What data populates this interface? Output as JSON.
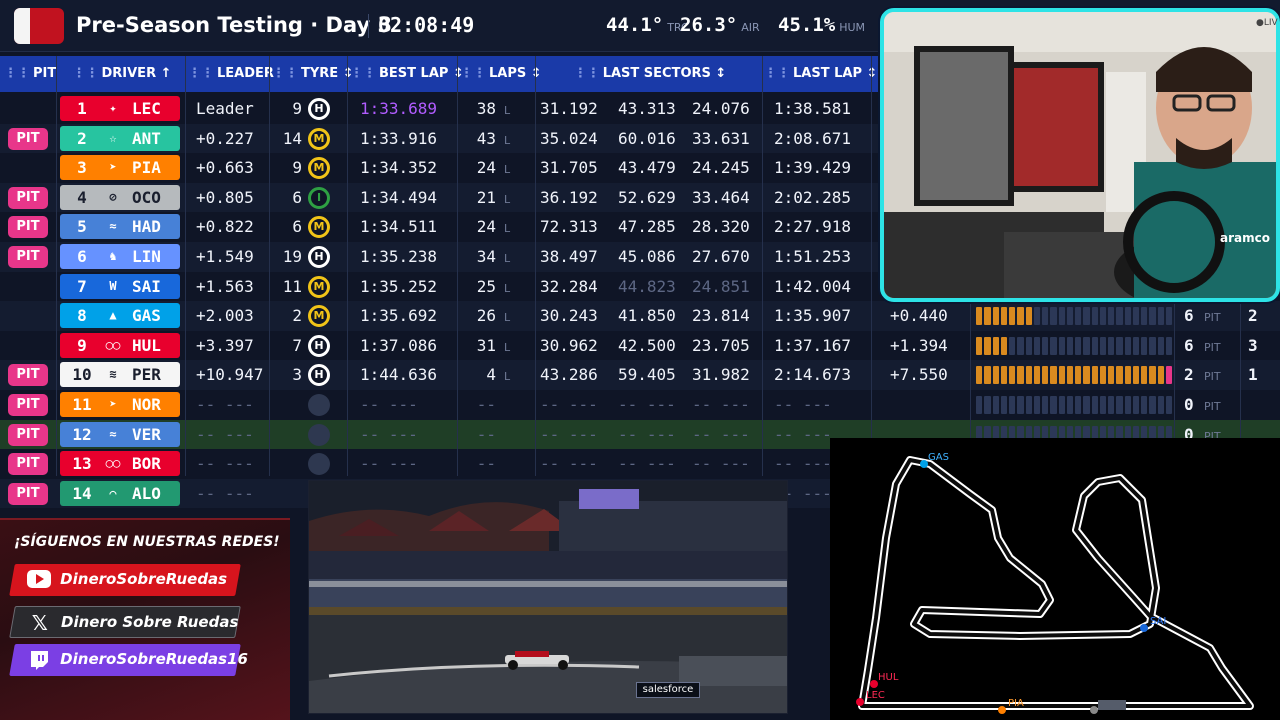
{
  "header": {
    "title": "Pre-Season Testing · Day 3",
    "clock": "02:08:49",
    "track_temp": "44.1°",
    "track_temp_label": "TRC",
    "air_temp": "26.3°",
    "air_temp_label": "AIR",
    "humidity": "45.1%",
    "humidity_label": "HUM"
  },
  "columns": {
    "pit": "PIT",
    "driver": "DRIVER ↑",
    "leader": "LEADER",
    "tyre": "TYRE ↕",
    "best_lap": "BEST LAP ↕",
    "laps": "LAPS ↕",
    "last_sectors": "LAST SECTORS ↕",
    "last_lap": "LAST LAP ↕"
  },
  "rows": [
    {
      "pit": "",
      "pos": "1",
      "logo": "✦",
      "code": "LEC",
      "leader": "Leader",
      "stint": "9",
      "tyre": "H",
      "best": "1:33.689",
      "laps": "38",
      "lap_unit": "L",
      "s1": "31.192",
      "s2": "43.313",
      "s3": "24.076",
      "last": "1:38.581",
      "gap": "",
      "pits": "",
      "pit_label": "",
      "extra": ""
    },
    {
      "pit": "PIT",
      "pos": "2",
      "logo": "☆",
      "code": "ANT",
      "leader": "+0.227",
      "stint": "14",
      "tyre": "M",
      "best": "1:33.916",
      "laps": "43",
      "lap_unit": "L",
      "s1": "35.024",
      "s2": "60.016",
      "s3": "33.631",
      "last": "2:08.671",
      "gap": "",
      "pits": "",
      "pit_label": "",
      "extra": ""
    },
    {
      "pit": "",
      "pos": "3",
      "logo": "➤",
      "code": "PIA",
      "leader": "+0.663",
      "stint": "9",
      "tyre": "M",
      "best": "1:34.352",
      "laps": "24",
      "lap_unit": "L",
      "s1": "31.705",
      "s2": "43.479",
      "s3": "24.245",
      "last": "1:39.429",
      "gap": "",
      "pits": "",
      "pit_label": "",
      "extra": ""
    },
    {
      "pit": "PIT",
      "pos": "4",
      "logo": "⊘",
      "code": "OCO",
      "leader": "+0.805",
      "stint": "6",
      "tyre": "I",
      "best": "1:34.494",
      "laps": "21",
      "lap_unit": "L",
      "s1": "36.192",
      "s2": "52.629",
      "s3": "33.464",
      "last": "2:02.285",
      "gap": "",
      "pits": "",
      "pit_label": "",
      "extra": ""
    },
    {
      "pit": "PIT",
      "pos": "5",
      "logo": "≈",
      "code": "HAD",
      "leader": "+0.822",
      "stint": "6",
      "tyre": "M",
      "best": "1:34.511",
      "laps": "24",
      "lap_unit": "L",
      "s1": "72.313",
      "s2": "47.285",
      "s3": "28.320",
      "last": "2:27.918",
      "gap": "",
      "pits": "",
      "pit_label": "",
      "extra": ""
    },
    {
      "pit": "PIT",
      "pos": "6",
      "logo": "♞",
      "code": "LIN",
      "leader": "+1.549",
      "stint": "19",
      "tyre": "H",
      "best": "1:35.238",
      "laps": "34",
      "lap_unit": "L",
      "s1": "38.497",
      "s2": "45.086",
      "s3": "27.670",
      "last": "1:51.253",
      "gap": "",
      "pits": "",
      "pit_label": "",
      "extra": ""
    },
    {
      "pit": "",
      "pos": "7",
      "logo": "W",
      "code": "SAI",
      "leader": "+1.563",
      "stint": "11",
      "tyre": "M",
      "best": "1:35.252",
      "laps": "25",
      "lap_unit": "L",
      "s1": "32.284",
      "s2": "44.823",
      "s3": "24.851",
      "last": "1:42.004",
      "gap": "",
      "pits": "",
      "pit_label": "",
      "extra": ""
    },
    {
      "pit": "",
      "pos": "8",
      "logo": "▲",
      "code": "GAS",
      "leader": "+2.003",
      "stint": "2",
      "tyre": "M",
      "best": "1:35.692",
      "laps": "26",
      "lap_unit": "L",
      "s1": "30.243",
      "s2": "41.850",
      "s3": "23.814",
      "last": "1:35.907",
      "gap": "+0.440",
      "pits": "6",
      "pit_label": "PIT",
      "extra": "2"
    },
    {
      "pit": "",
      "pos": "9",
      "logo": "◯◯",
      "code": "HUL",
      "leader": "+3.397",
      "stint": "7",
      "tyre": "H",
      "best": "1:37.086",
      "laps": "31",
      "lap_unit": "L",
      "s1": "30.962",
      "s2": "42.500",
      "s3": "23.705",
      "last": "1:37.167",
      "gap": "+1.394",
      "pits": "6",
      "pit_label": "PIT",
      "extra": "3"
    },
    {
      "pit": "PIT",
      "pos": "10",
      "logo": "≋",
      "code": "PER",
      "leader": "+10.947",
      "stint": "3",
      "tyre": "H",
      "best": "1:44.636",
      "laps": "4",
      "lap_unit": "L",
      "s1": "43.286",
      "s2": "59.405",
      "s3": "31.982",
      "last": "2:14.673",
      "gap": "+7.550",
      "pits": "2",
      "pit_label": "PIT",
      "extra": "1"
    },
    {
      "pit": "PIT",
      "pos": "11",
      "logo": "➤",
      "code": "NOR",
      "leader": "-- ---",
      "stint": "",
      "tyre": "",
      "best": "-- ---",
      "laps": "--",
      "lap_unit": "",
      "s1": "-- ---",
      "s2": "-- ---",
      "s3": "-- ---",
      "last": "-- ---",
      "gap": "",
      "pits": "0",
      "pit_label": "PIT",
      "extra": ""
    },
    {
      "pit": "PIT",
      "pos": "12",
      "logo": "≈",
      "code": "VER",
      "leader": "-- ---",
      "stint": "",
      "tyre": "",
      "best": "-- ---",
      "laps": "--",
      "lap_unit": "",
      "s1": "-- ---",
      "s2": "-- ---",
      "s3": "-- ---",
      "last": "-- ---",
      "gap": "",
      "pits": "0",
      "pit_label": "PIT",
      "extra": ""
    },
    {
      "pit": "PIT",
      "pos": "13",
      "logo": "◯◯",
      "code": "BOR",
      "leader": "-- ---",
      "stint": "",
      "tyre": "",
      "best": "-- ---",
      "laps": "--",
      "lap_unit": "",
      "s1": "-- ---",
      "s2": "-- ---",
      "s3": "-- ---",
      "last": "-- ---",
      "gap": "",
      "pits": "",
      "pit_label": "",
      "extra": ""
    },
    {
      "pit": "PIT",
      "pos": "14",
      "logo": "⌒",
      "code": "ALO",
      "leader": "-- ---",
      "stint": "",
      "tyre": "",
      "best": "-- ---",
      "laps": "--",
      "lap_unit": "",
      "s1": "-- ---",
      "s2": "-- ---",
      "s3": "-- ---",
      "last": "-- ---",
      "gap": "",
      "pits": "",
      "pit_label": "",
      "extra": ""
    }
  ],
  "gap_bar_levels": [
    0,
    0,
    0,
    0,
    0,
    0,
    0,
    0.3,
    0.15,
    0.95,
    0,
    0,
    0,
    0
  ],
  "team_colors": {
    "LEC": "#e8002d",
    "ANT": "#27c4a0",
    "PIA": "#ff8000",
    "OCO": "#b6babd",
    "HAD": "#4781d7",
    "LIN": "#6692ff",
    "SAI": "#1868db",
    "GAS": "#00a1e8",
    "HUL": "#e8002d",
    "PER": "#f5f5f5",
    "NOR": "#ff8000",
    "VER": "#4781d7",
    "BOR": "#e8002d",
    "ALO": "#229971"
  },
  "socials": {
    "title": "¡SÍGUENOS EN NUESTRAS REDES!",
    "youtube": "DineroSobreRuedas",
    "x": "Dinero Sobre Ruedas",
    "twitch": "DineroSobreRuedas16"
  },
  "video": {
    "sponsor": "salesforce"
  },
  "map": {
    "labels": {
      "GAS": "GAS",
      "SAI": "SAI",
      "HUL": "HUL",
      "LEC": "LEC",
      "PIA": "PIA"
    }
  },
  "webcam": {
    "live": "●LIV"
  }
}
